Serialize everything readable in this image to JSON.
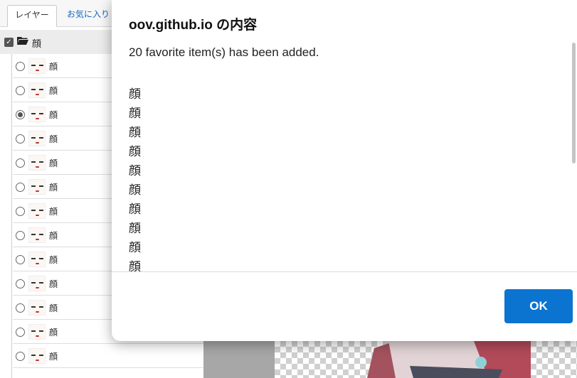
{
  "panel": {
    "tabs": [
      "レイヤー",
      "お気に入り"
    ],
    "root": {
      "label": "顔",
      "checked": true
    },
    "rows": [
      {
        "label": "顔",
        "selected": false
      },
      {
        "label": "顔",
        "selected": false
      },
      {
        "label": "顔",
        "selected": true
      },
      {
        "label": "顔",
        "selected": false
      },
      {
        "label": "顔",
        "selected": false
      },
      {
        "label": "顔",
        "selected": false
      },
      {
        "label": "顔",
        "selected": false
      },
      {
        "label": "顔",
        "selected": false
      },
      {
        "label": "顔",
        "selected": false
      },
      {
        "label": "顔",
        "selected": false
      },
      {
        "label": "顔",
        "selected": false
      },
      {
        "label": "顔",
        "selected": false
      },
      {
        "label": "顔",
        "selected": false
      }
    ]
  },
  "dialog": {
    "title": "oov.github.io の内容",
    "message": "20 favorite item(s) has been added.",
    "items": [
      "顔",
      "顔",
      "顔",
      "顔",
      "顔",
      "顔",
      "顔",
      "顔",
      "顔",
      "顔"
    ],
    "ok_label": "OK"
  },
  "colors": {
    "accent": "#0b74d0",
    "panel_bg": "#f7f7f7"
  }
}
